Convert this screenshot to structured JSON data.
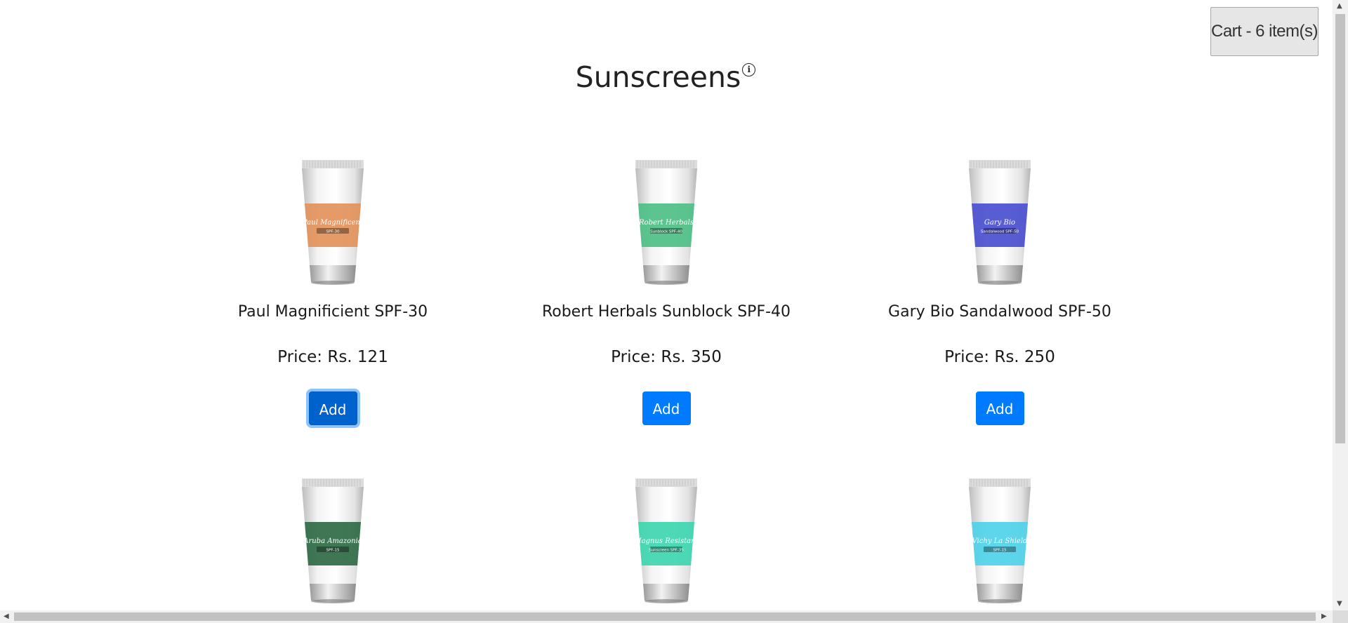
{
  "header": {
    "cart_label": "Cart - 6 item(s)",
    "title": "Sunscreens",
    "info_glyph": "i"
  },
  "products": [
    {
      "name": "Paul Magnificient SPF-30",
      "price": "Price: Rs. 121",
      "add_label": "Add",
      "tube_color": "#e2935a",
      "brand_text": "Paul Magnificent",
      "sub_text": "SPF-30"
    },
    {
      "name": "Robert Herbals Sunblock SPF-40",
      "price": "Price: Rs. 350",
      "add_label": "Add",
      "tube_color": "#4dbf86",
      "brand_text": "Robert Herbals",
      "sub_text": "Sunblock SPF-40"
    },
    {
      "name": "Gary Bio Sandalwood SPF-50",
      "price": "Price: Rs. 250",
      "add_label": "Add",
      "tube_color": "#4a4fd0",
      "brand_text": "Gary Bio",
      "sub_text": "Sandalwood SPF-50"
    },
    {
      "tube_color": "#2f6b46",
      "brand_text": "Aruba Amazonia",
      "sub_text": "SPF-15"
    },
    {
      "tube_color": "#3fd6b0",
      "brand_text": "Magnus Resistant",
      "sub_text": "Sunscreen SPF-35"
    },
    {
      "tube_color": "#4fd2ea",
      "brand_text": "Vichy La Shield",
      "sub_text": "SPF-15"
    }
  ],
  "colors": {
    "primary": "#007bff",
    "primary_focus": "#0062cc"
  }
}
